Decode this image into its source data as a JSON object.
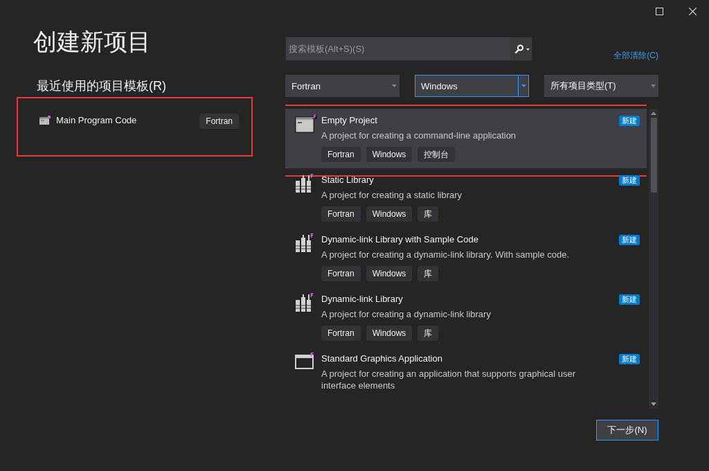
{
  "title": "创建新项目",
  "recent": {
    "heading": "最近使用的项目模板(R)",
    "items": [
      {
        "name": "Main Program Code",
        "tag": "Fortran",
        "highlighted": true
      }
    ]
  },
  "search": {
    "placeholder": "搜索模板(Alt+S)(S)"
  },
  "clear_all": "全部清除(C)",
  "filters": [
    {
      "value": "Fortran",
      "focused": false
    },
    {
      "value": "Windows",
      "focused": true
    },
    {
      "value": "所有项目类型(T)",
      "focused": false
    }
  ],
  "templates": [
    {
      "kind": "console",
      "name": "Empty Project",
      "description": "A project for creating a command-line application",
      "badge": "新建",
      "tags": [
        "Fortran",
        "Windows",
        "控制台"
      ],
      "selected": true,
      "highlighted": true
    },
    {
      "kind": "library",
      "name": "Static Library",
      "description": "A project for creating a static library",
      "badge": "新建",
      "tags": [
        "Fortran",
        "Windows",
        "库"
      ],
      "selected": false,
      "highlighted": false
    },
    {
      "kind": "library",
      "name": "Dynamic-link Library with Sample Code",
      "description": "A project for creating a dynamic-link library. With sample code.",
      "badge": "新建",
      "tags": [
        "Fortran",
        "Windows",
        "库"
      ],
      "selected": false,
      "highlighted": false
    },
    {
      "kind": "library",
      "name": "Dynamic-link Library",
      "description": "A project for creating a dynamic-link library",
      "badge": "新建",
      "tags": [
        "Fortran",
        "Windows",
        "库"
      ],
      "selected": false,
      "highlighted": false
    },
    {
      "kind": "window",
      "name": "Standard Graphics Application",
      "description": "A project for creating an application that supports graphical user interface elements",
      "badge": "新建",
      "selected": false,
      "highlighted": false
    }
  ],
  "next_button": "下一步(N)"
}
